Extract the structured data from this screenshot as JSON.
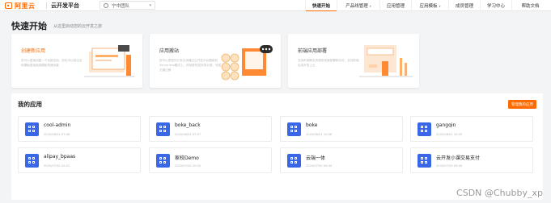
{
  "header": {
    "logo_text": "阿里云",
    "platform": "云开发平台",
    "team": "宁中团队",
    "nav": [
      {
        "label": "快速开始",
        "active": true,
        "dropdown": false
      },
      {
        "label": "产品线管理",
        "active": false,
        "dropdown": true
      },
      {
        "label": "应用管理",
        "active": false,
        "dropdown": false
      },
      {
        "label": "应用模板",
        "active": false,
        "dropdown": true
      },
      {
        "label": "成员管理",
        "active": false,
        "dropdown": false
      },
      {
        "label": "学习中心",
        "active": false,
        "dropdown": false
      },
      {
        "label": "帮助文档",
        "active": false,
        "dropdown": false
      }
    ]
  },
  "quick_start": {
    "title": "快速开始",
    "subtitle": "从这里启动您的云开发之旅",
    "cards": [
      {
        "title": "创建新应用",
        "desc": "您可以直接创建一个全新应用，您也可以前往应用模板直接使用模板快速创建"
      },
      {
        "title": "应用搬站",
        "desc": "您可以把您的已有应用通过云开发平台搬家到Serverless模式上，体验更低成本的计费，完成无缝迁移"
      },
      {
        "title": "前端应用部署",
        "desc": "支持前端静态资源的快速部署和访问，支持前端应用开发上云"
      }
    ]
  },
  "my_apps": {
    "title": "我的应用",
    "manage_label": "管理我的应用",
    "apps": [
      {
        "name": "cool-admin",
        "date": "2020/08/01 07:08"
      },
      {
        "name": "boke_back",
        "date": "2020/08/01 07:07"
      },
      {
        "name": "boke",
        "date": "2020/08/01 10:06"
      },
      {
        "name": "gangqin",
        "date": "2020/08/01 10:05"
      },
      {
        "name": "alipay_bpaas",
        "date": "2020/07/30 20:22"
      },
      {
        "name": "家校Demo",
        "date": "2020/07/30 20:20"
      },
      {
        "name": "云端一体",
        "date": "2020/07/30 09:34"
      },
      {
        "name": "云开发小课交易支付",
        "date": "2020/07/30 09:09"
      }
    ]
  },
  "watermark": "CSDN @Chubby_xp",
  "colors": {
    "accent": "#ff6a00",
    "app_icon": "#3a66e8"
  }
}
